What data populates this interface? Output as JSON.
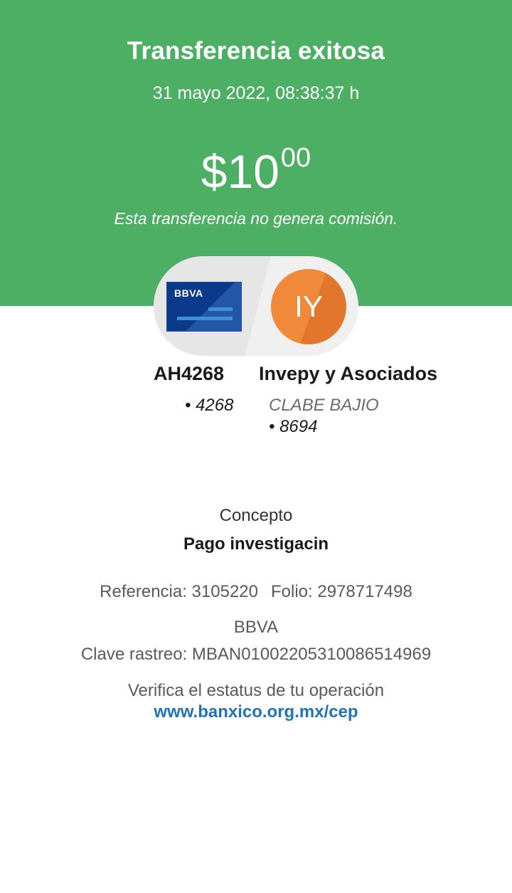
{
  "header": {
    "title": "Transferencia exitosa",
    "datetime": "31 mayo 2022, 08:38:37 h",
    "amount_main": "$10",
    "amount_cents": "00",
    "commission_note": "Esta transferencia no genera comisión."
  },
  "accounts": {
    "origin": {
      "card_logo": "BBVA",
      "name": "AH4268",
      "number": "• 4268",
      "icon": "bank-card-icon"
    },
    "destination": {
      "initials": "IY",
      "name": "Invepy y Asociados",
      "bank": "CLABE BAJIO",
      "number": "• 8694"
    }
  },
  "details": {
    "concept_label": "Concepto",
    "concept_value": "Pago investigacin",
    "reference_label": "Referencia: 3105220",
    "folio_label": "Folio: 2978717498",
    "bank": "BBVA",
    "tracking": "Clave rastreo: MBAN01002205310086514969",
    "verify_text": "Verifica el estatus de tu operación",
    "verify_link": "www.banxico.org.mx/cep"
  },
  "colors": {
    "header_green": "#4caf64",
    "card_blue": "#0b3a8a",
    "avatar_orange": "#f08a3a",
    "link_blue": "#1f73b7"
  }
}
